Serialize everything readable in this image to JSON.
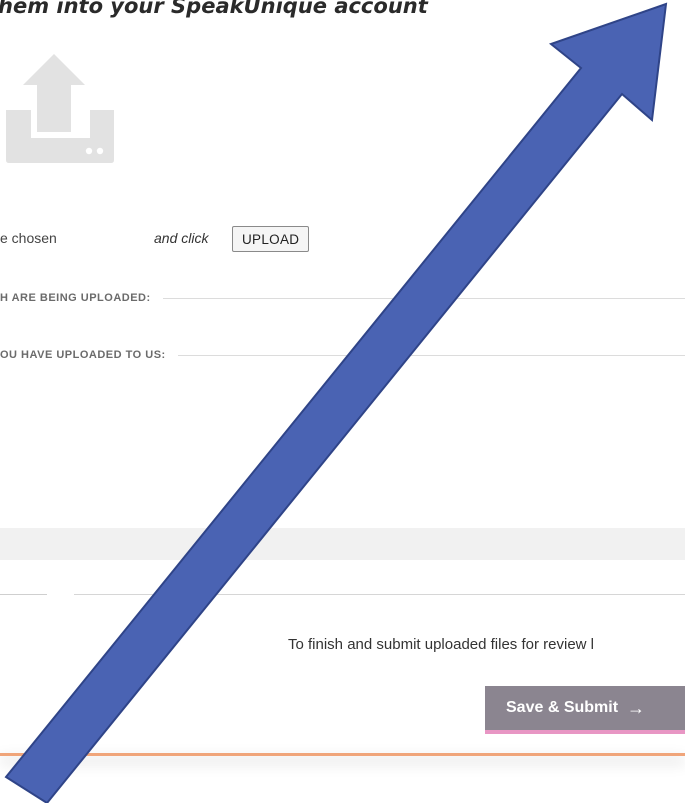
{
  "header": {
    "title": "hem into your SpeakUnique account"
  },
  "upload": {
    "icon": "upload-tray-icon",
    "file_status": "e chosen",
    "and_click": "and click",
    "upload_button": "UPLOAD"
  },
  "sections": {
    "being_uploaded": "H ARE BEING UPLOADED:",
    "uploaded": "OU HAVE UPLOADED TO US:"
  },
  "footer": {
    "finish_text": "To finish and submit uploaded files for review l",
    "save_submit_label": "Save & Submit",
    "save_submit_arrow": "→"
  },
  "colors": {
    "annotation_arrow": "#4a63b3",
    "save_button_bg": "#8b8590",
    "save_button_underline": "#e896c4",
    "footer_accent": "#f0a57a"
  }
}
